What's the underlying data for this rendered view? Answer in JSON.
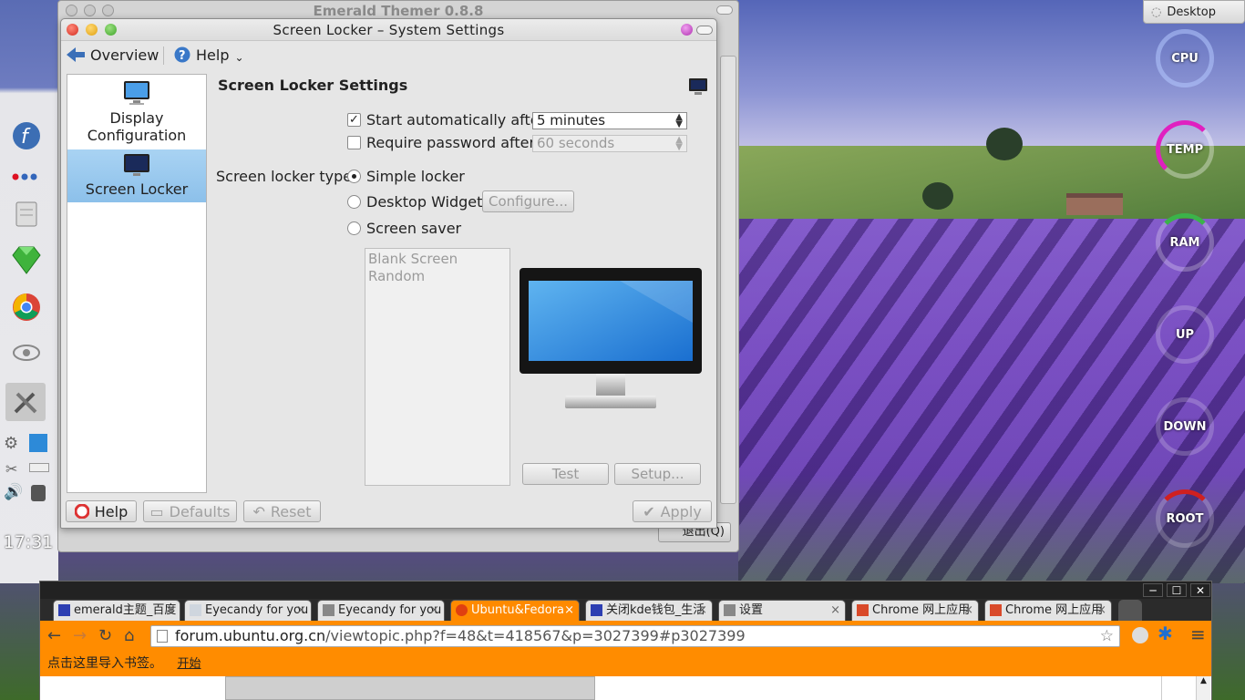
{
  "desktop": {
    "clock": "17:31",
    "desktop_tab": "Desktop",
    "gauges": [
      "CPU",
      "TEMP",
      "RAM",
      "UP",
      "DOWN",
      "ROOT"
    ]
  },
  "emerald": {
    "title": "Emerald Themer 0.8.8",
    "quit_label": "退出(Q)"
  },
  "window": {
    "title": "Screen Locker – System Settings",
    "toolbar": {
      "overview": "Overview",
      "help": "Help"
    },
    "sidebar": [
      {
        "label": "Display Configuration",
        "active": false
      },
      {
        "label": "Screen Locker",
        "active": true
      }
    ],
    "heading": "Screen Locker Settings",
    "start_auto_label": "Start automatically after:",
    "start_auto_checked": true,
    "start_auto_value": "5 minutes",
    "require_pw_label": "Require password after:",
    "require_pw_checked": false,
    "require_pw_value": "60 seconds",
    "type_label": "Screen locker type:",
    "types": [
      "Simple locker",
      "Desktop Widgets",
      "Screen saver"
    ],
    "selected_type": "Simple locker",
    "configure_label": "Configure...",
    "savers": [
      "Blank Screen",
      "Random"
    ],
    "test_label": "Test",
    "setup_label": "Setup...",
    "footer": {
      "help": "Help",
      "defaults": "Defaults",
      "reset": "Reset",
      "apply": "Apply"
    }
  },
  "browser": {
    "tabs": [
      {
        "label": "emerald主题_百度",
        "active": false
      },
      {
        "label": "Eyecandy for you",
        "active": false
      },
      {
        "label": "Eyecandy for you",
        "active": false
      },
      {
        "label": "Ubuntu&Fedora",
        "active": true
      },
      {
        "label": "关闭kde钱包_生活",
        "active": false
      },
      {
        "label": "设置",
        "active": false
      },
      {
        "label": "Chrome 网上应用",
        "active": false
      },
      {
        "label": "Chrome 网上应用",
        "active": false
      }
    ],
    "url_host": "forum.ubuntu.org.cn",
    "url_path": "/viewtopic.php?f=48&t=418567&p=3027399#p3027399",
    "bookmark_prompt": "点击这里导入书签。",
    "bookmark_start": "开始"
  },
  "colors": {
    "accent_orange": "#ff8c00",
    "selection_blue": "#8cc0ea"
  }
}
